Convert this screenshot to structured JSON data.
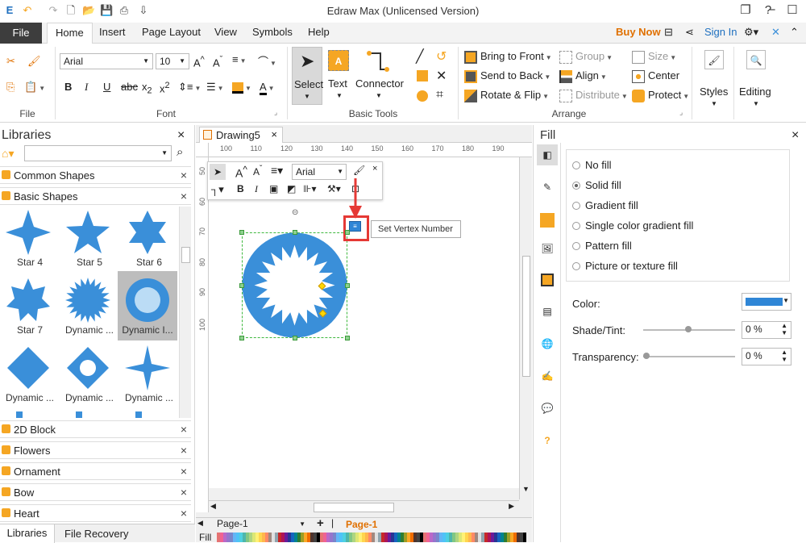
{
  "window": {
    "title": "Edraw Max (Unlicensed Version)"
  },
  "tabs": {
    "file": "File",
    "home": "Home",
    "insert": "Insert",
    "page_layout": "Page Layout",
    "view": "View",
    "symbols": "Symbols",
    "help": "Help"
  },
  "account": {
    "buy_now": "Buy Now",
    "sign_in": "Sign In"
  },
  "ribbon": {
    "font_name": "Arial",
    "font_size": "10",
    "groups": {
      "file": "File",
      "font": "Font",
      "basic_tools": "Basic Tools",
      "arrange": "Arrange"
    },
    "tools": {
      "select": "Select",
      "text": "Text",
      "connector": "Connector"
    },
    "arrange": {
      "bring_to_front": "Bring to Front",
      "send_to_back": "Send to Back",
      "rotate_flip": "Rotate & Flip",
      "group": "Group",
      "align": "Align",
      "distribute": "Distribute",
      "size": "Size",
      "center": "Center",
      "protect": "Protect"
    },
    "styles": "Styles",
    "editing": "Editing"
  },
  "libraries": {
    "title": "Libraries",
    "categories_open": [
      "Common Shapes",
      "Basic Shapes"
    ],
    "shapes": [
      "Star 4",
      "Star 5",
      "Star 6",
      "Star 7",
      "Dynamic ...",
      "Dynamic I...",
      "Dynamic ...",
      "Dynamic ...",
      "Dynamic ..."
    ],
    "categories_closed": [
      "2D Block",
      "Flowers",
      "Ornament",
      "Bow",
      "Heart"
    ],
    "bottom_tabs": [
      "Libraries",
      "File Recovery"
    ]
  },
  "document": {
    "tab_name": "Drawing5",
    "ruler_h": [
      "100",
      "110",
      "120",
      "130",
      "140",
      "150",
      "160",
      "170",
      "180",
      "190"
    ],
    "ruler_v": [
      "50",
      "60",
      "70",
      "80",
      "90",
      "100"
    ],
    "mini_toolbar_font": "Arial",
    "tooltip": "Set Vertex Number",
    "page_selector": "Page-1",
    "page_tab": "Page-1",
    "fill_label": "Fill"
  },
  "fill_panel": {
    "title": "Fill",
    "options": [
      "No fill",
      "Solid fill",
      "Gradient fill",
      "Single color gradient fill",
      "Pattern fill",
      "Picture or texture fill"
    ],
    "selected": "Solid fill",
    "color_label": "Color:",
    "color_value": "#2f86d6",
    "shade_label": "Shade/Tint:",
    "shade_value": "0 %",
    "transparency_label": "Transparency:",
    "transparency_value": "0 %"
  },
  "colors": {
    "accent": "#2f86d6",
    "shape_blue": "#3a8fd9",
    "highlight": "#e53935",
    "orange": "#f5a623"
  }
}
